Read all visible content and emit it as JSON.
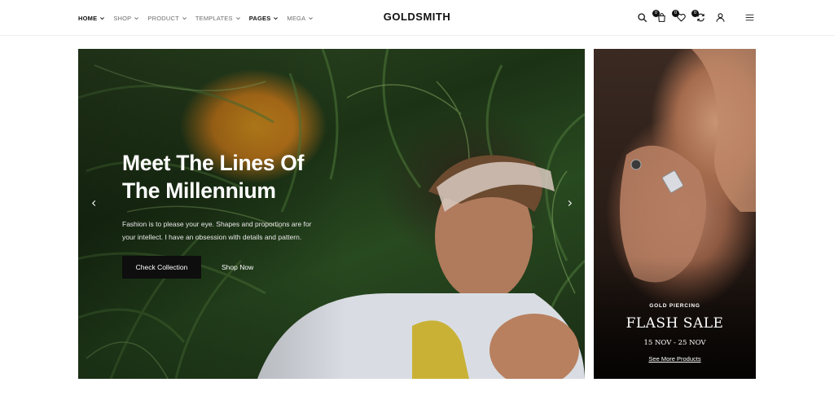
{
  "header": {
    "brand": "GOLDSMITH",
    "nav": [
      {
        "label": "HOME",
        "active": true,
        "has_dropdown": true
      },
      {
        "label": "SHOP",
        "active": false,
        "has_dropdown": true
      },
      {
        "label": "PRODUCT",
        "active": false,
        "has_dropdown": true
      },
      {
        "label": "TEMPLATES",
        "active": false,
        "has_dropdown": true
      },
      {
        "label": "PAGES",
        "active": true,
        "has_dropdown": true
      },
      {
        "label": "MEGA",
        "active": false,
        "has_dropdown": true
      }
    ],
    "icons": {
      "search": "search-icon",
      "cart": {
        "icon": "cart-icon",
        "count": "0"
      },
      "wishlist": {
        "icon": "heart-icon",
        "count": "0"
      },
      "compare": {
        "icon": "compare-icon",
        "count": "0"
      },
      "account": "user-icon",
      "menu": "hamburger-icon"
    }
  },
  "hero": {
    "title_line1": "Meet The Lines Of",
    "title_line2": "The Millennium",
    "description": "Fashion is to please your eye. Shapes and proportions are for your intellect. I have an obsession with details and pattern.",
    "primary_button": "Check Collection",
    "secondary_link": "Shop Now",
    "arrows": {
      "prev": "chevron-left-icon",
      "next": "chevron-right-icon"
    }
  },
  "promo": {
    "eyebrow": "GOLD PIERCING",
    "title": "FLASH SALE",
    "dates": "15 NOV - 25 NOV",
    "link": "See More Products"
  },
  "colors": {
    "text": "#111111",
    "nav_muted": "#6f6f6f",
    "button_bg": "#0e0e0e",
    "white": "#ffffff"
  }
}
